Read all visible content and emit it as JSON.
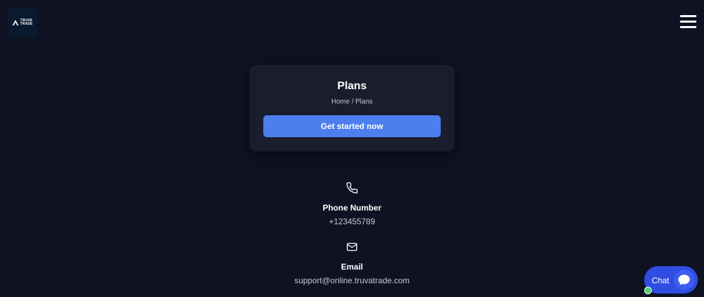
{
  "header": {
    "logo_line1": "TRUVA",
    "logo_line2": "TRADE",
    "menu_icon": "hamburger-menu-icon"
  },
  "hero": {
    "title": "Plans",
    "breadcrumb": "Home / Plans",
    "cta_label": "Get started now"
  },
  "contact": {
    "phone": {
      "icon": "phone-icon",
      "label": "Phone Number",
      "value": "+123455789"
    },
    "email": {
      "icon": "mail-icon",
      "label": "Email",
      "value": "support@online.truvatrade.com"
    }
  },
  "chat": {
    "label": "Chat",
    "icon": "chat-bubble-icon",
    "status": "online"
  },
  "colors": {
    "background": "#0e1222",
    "card": "#191d2d",
    "accent": "#4c7fed",
    "chat": "#2f4de0",
    "online": "#4fd06b"
  }
}
